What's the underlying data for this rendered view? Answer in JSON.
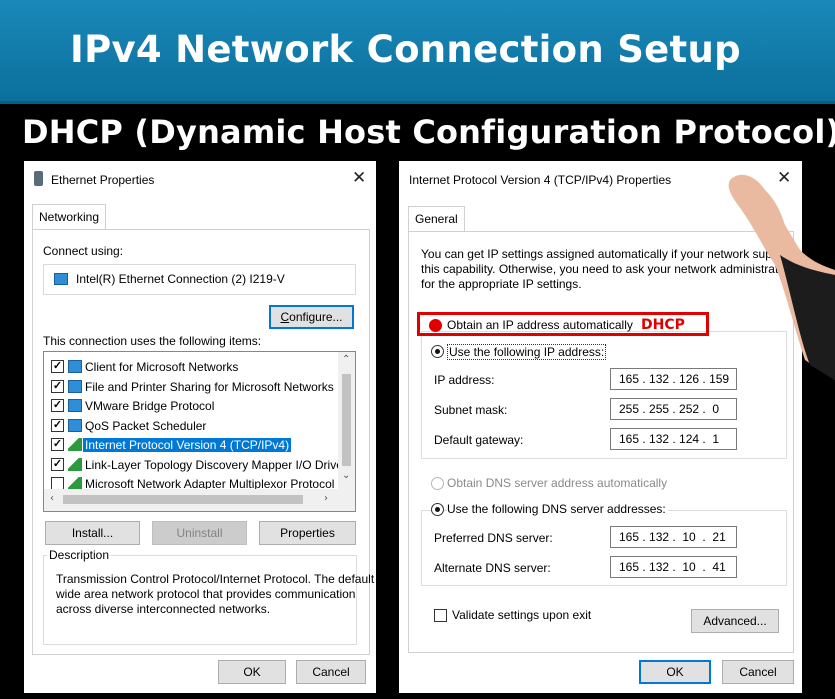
{
  "slide": {
    "title": "IPv4 Network Connection Setup",
    "subtitle": "DHCP (Dynamic Host Configuration Protocol)"
  },
  "eth_window": {
    "title": "Ethernet Properties",
    "tab": "Networking",
    "connect_using_label": "Connect using:",
    "adapter": "Intel(R) Ethernet Connection (2) I219-V",
    "configure_button": "Configure...",
    "items_label": "This connection uses the following items:",
    "items": [
      {
        "label": "Client for Microsoft Networks",
        "checked": true,
        "icon": "network-icon",
        "selected": false
      },
      {
        "label": "File and Printer Sharing for Microsoft Networks",
        "checked": true,
        "icon": "network-icon",
        "selected": false
      },
      {
        "label": "VMware Bridge Protocol",
        "checked": true,
        "icon": "network-icon",
        "selected": false
      },
      {
        "label": "QoS Packet Scheduler",
        "checked": true,
        "icon": "network-icon",
        "selected": false
      },
      {
        "label": "Internet Protocol Version 4 (TCP/IPv4)",
        "checked": true,
        "icon": "protocol-icon",
        "selected": true
      },
      {
        "label": "Link-Layer Topology Discovery Mapper I/O Driver",
        "checked": true,
        "icon": "protocol-icon",
        "selected": false
      },
      {
        "label": "Microsoft Network Adapter Multiplexor Protocol",
        "checked": false,
        "icon": "protocol-icon",
        "selected": false
      }
    ],
    "install_button": "Install...",
    "uninstall_button": "Uninstall",
    "properties_button": "Properties",
    "description_label": "Description",
    "description_lines": [
      "Transmission Control Protocol/Internet Protocol. The default",
      "wide area network protocol that provides communication",
      "across diverse interconnected networks."
    ],
    "ok_button": "OK",
    "cancel_button": "Cancel"
  },
  "ipv4_window": {
    "title": "Internet Protocol Version 4 (TCP/IPv4) Properties",
    "tab": "General",
    "intro_lines": [
      "You can get IP settings assigned automatically if your network support",
      "this capability. Otherwise, you need to ask your network administrator",
      "for the appropriate IP settings."
    ],
    "obtain_ip_auto": "Obtain an IP address automatically",
    "dhcp_tag": "DHCP",
    "use_following_ip": "Use the following IP address:",
    "ip_address_label": "IP address:",
    "ip_address": "165 . 132 . 126 . 159",
    "subnet_mask_label": "Subnet mask:",
    "subnet_mask": "255 . 255 . 252 .  0",
    "default_gateway_label": "Default gateway:",
    "default_gateway": "165 . 132 . 124 .  1",
    "obtain_dns_auto": "Obtain DNS server address automatically",
    "use_following_dns": "Use the following DNS server addresses:",
    "preferred_dns_label": "Preferred DNS server:",
    "preferred_dns": "165 . 132 .  10  .  21",
    "alternate_dns_label": "Alternate DNS server:",
    "alternate_dns": "165 . 132 .  10  .  41",
    "validate_label": "Validate settings upon exit",
    "advanced_button": "Advanced...",
    "ok_button": "OK",
    "cancel_button": "Cancel"
  },
  "colors": {
    "banner": "#1a89b9",
    "selection": "#0078d7",
    "highlight_red": "#e00000"
  }
}
